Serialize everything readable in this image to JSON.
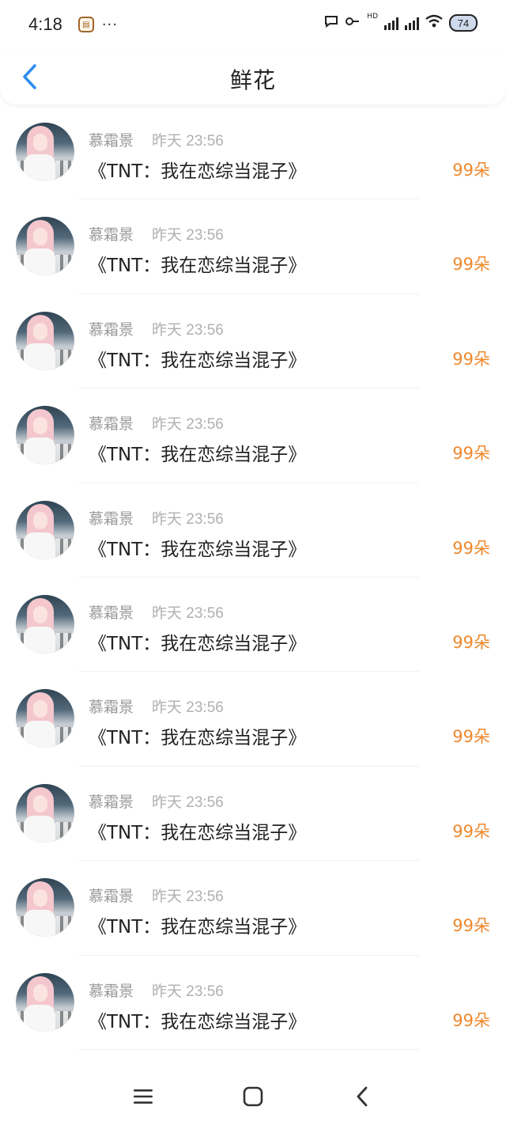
{
  "status_bar": {
    "time": "4:18",
    "more": "···",
    "hd_label": "HD",
    "battery": "74"
  },
  "header": {
    "title": "鲜花"
  },
  "list": [
    {
      "username": "慕霜景",
      "time": "昨天 23:56",
      "book_title": "《TNT：我在恋综当混子》",
      "count": "99朵"
    },
    {
      "username": "慕霜景",
      "time": "昨天 23:56",
      "book_title": "《TNT：我在恋综当混子》",
      "count": "99朵"
    },
    {
      "username": "慕霜景",
      "time": "昨天 23:56",
      "book_title": "《TNT：我在恋综当混子》",
      "count": "99朵"
    },
    {
      "username": "慕霜景",
      "time": "昨天 23:56",
      "book_title": "《TNT：我在恋综当混子》",
      "count": "99朵"
    },
    {
      "username": "慕霜景",
      "time": "昨天 23:56",
      "book_title": "《TNT：我在恋综当混子》",
      "count": "99朵"
    },
    {
      "username": "慕霜景",
      "time": "昨天 23:56",
      "book_title": "《TNT：我在恋综当混子》",
      "count": "99朵"
    },
    {
      "username": "慕霜景",
      "time": "昨天 23:56",
      "book_title": "《TNT：我在恋综当混子》",
      "count": "99朵"
    },
    {
      "username": "慕霜景",
      "time": "昨天 23:56",
      "book_title": "《TNT：我在恋综当混子》",
      "count": "99朵"
    },
    {
      "username": "慕霜景",
      "time": "昨天 23:56",
      "book_title": "《TNT：我在恋综当混子》",
      "count": "99朵"
    },
    {
      "username": "慕霜景",
      "time": "昨天 23:56",
      "book_title": "《TNT：我在恋综当混子》",
      "count": "99朵"
    }
  ],
  "colors": {
    "accent_blue": "#2d8cf0",
    "count_orange": "#f0892d"
  },
  "icons": {
    "back": "chevron-left-icon",
    "menu": "menu-icon",
    "home": "home-square-icon",
    "system_back": "system-back-icon"
  }
}
